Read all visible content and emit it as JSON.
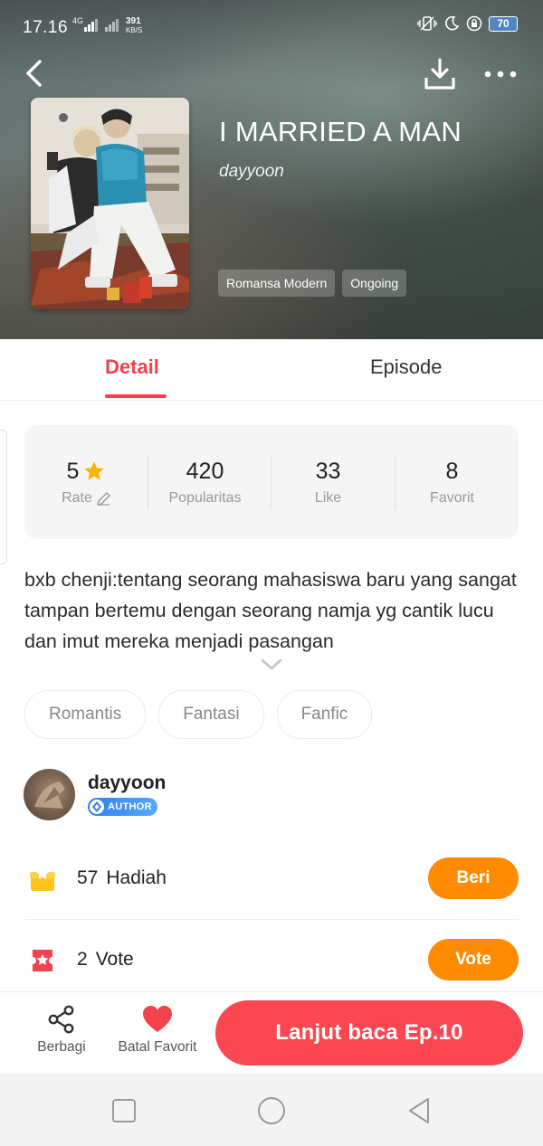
{
  "status_bar": {
    "time": "17.16",
    "network": "4G",
    "speed_value": "391",
    "speed_unit": "KB/S",
    "battery": "70"
  },
  "book": {
    "title": "I MARRIED A MAN",
    "author": "dayyoon",
    "genre_tags": [
      "Romansa Modern",
      "Ongoing"
    ]
  },
  "tabs": {
    "active": "Detail",
    "detail_label": "Detail",
    "episode_label": "Episode"
  },
  "stats": {
    "rate": {
      "value": "5",
      "label": "Rate"
    },
    "popularity": {
      "value": "420",
      "label": "Popularitas"
    },
    "like": {
      "value": "33",
      "label": "Like"
    },
    "favorite": {
      "value": "8",
      "label": "Favorit"
    }
  },
  "synopsis": "bxb chenji:tentang seorang mahasiswa baru yang sangat tampan bertemu dengan seorang namja yg cantik lucu dan imut mereka menjadi pasangan",
  "keywords": [
    "Romantis",
    "Fantasi",
    "Fanfic"
  ],
  "author_section": {
    "name": "dayyoon",
    "badge": "AUTHOR"
  },
  "gift": {
    "count": "57",
    "label": "Hadiah",
    "button": "Beri"
  },
  "vote": {
    "count": "2",
    "label": "Vote",
    "button": "Vote"
  },
  "bottom_bar": {
    "share_label": "Berbagi",
    "favorite_label": "Batal Favorit",
    "cta_label": "Lanjut baca Ep.10"
  },
  "colors": {
    "accent_red": "#f0424b",
    "cta_red": "#fb4751",
    "orange": "#ff8c00",
    "star_yellow": "#f7b500",
    "badge_blue": "#2f80ed"
  }
}
